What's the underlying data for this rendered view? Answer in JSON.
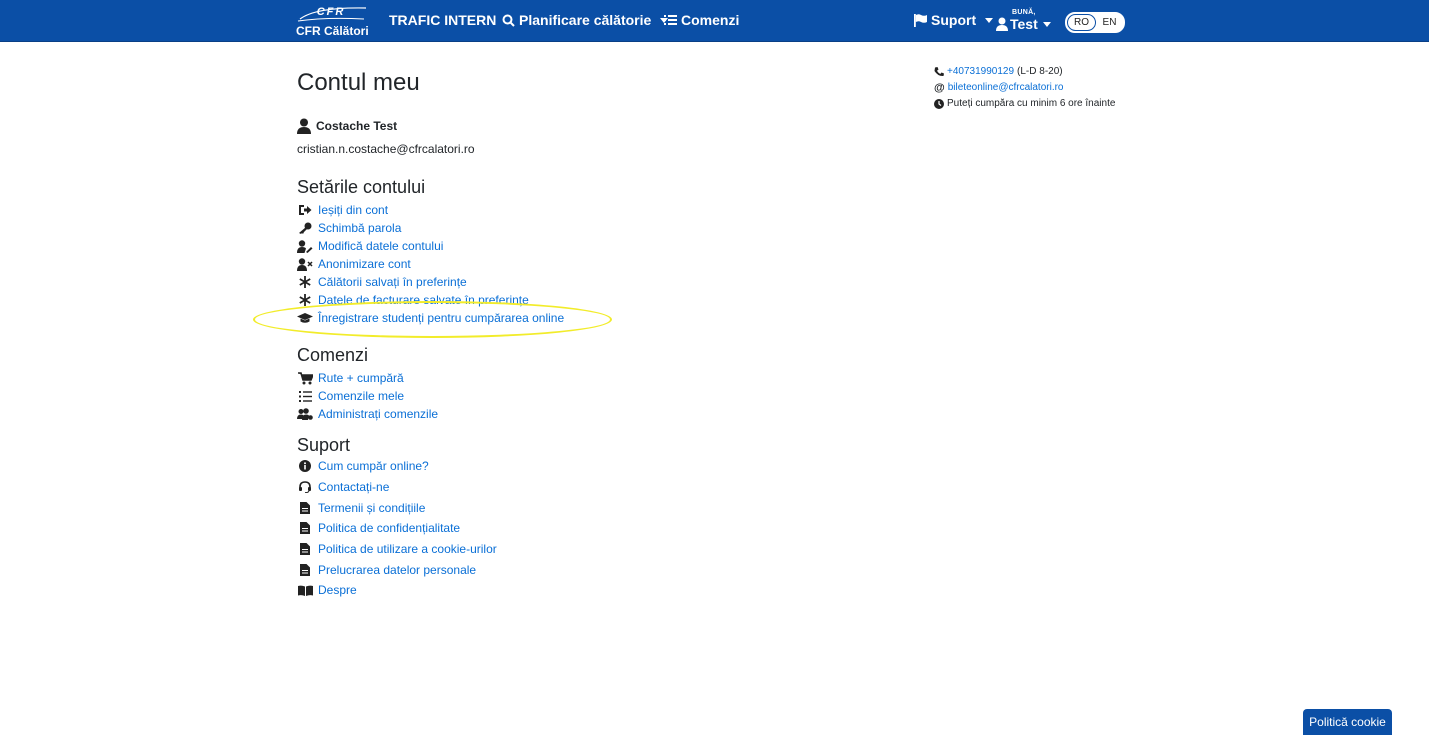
{
  "header": {
    "brand": {
      "mark": "CFR",
      "name": "CFR Călători"
    },
    "nav": {
      "trafic": "TRAFIC INTERN",
      "planificare": "Planificare călătorie",
      "comenzi": "Comenzi",
      "suport": "Suport"
    },
    "user": {
      "greeting": "BUNĂ,",
      "name": "Test"
    },
    "languages": [
      "RO",
      "EN"
    ],
    "active_language": "RO"
  },
  "page": {
    "title": "Contul meu",
    "user_name": "Costache Test",
    "user_email": "cristian.n.costache@cfrcalatori.ro"
  },
  "contact": {
    "phone": "+40731990129",
    "hours": "(L-D 8-20)",
    "email": "bileteonline@cfrcalatori.ro",
    "notice": "Puteți cumpăra cu minim 6 ore înainte"
  },
  "settings": {
    "title": "Setările contului",
    "items": [
      {
        "label": "Ieșiți din cont",
        "icon": "sign-out-icon"
      },
      {
        "label": "Schimbă parola",
        "icon": "key-icon"
      },
      {
        "label": "Modifică datele contului",
        "icon": "user-edit-icon"
      },
      {
        "label": "Anonimizare cont",
        "icon": "user-remove-icon"
      },
      {
        "label": "Călătorii salvați în preferințe",
        "icon": "asterisk-icon"
      },
      {
        "label": "Datele de facturare salvate în preferințe",
        "icon": "asterisk-icon"
      },
      {
        "label": "Înregistrare studenți pentru cumpărarea online",
        "icon": "graduation-cap-icon"
      }
    ]
  },
  "orders": {
    "title": "Comenzi",
    "items": [
      {
        "label": "Rute + cumpără",
        "icon": "cart-icon"
      },
      {
        "label": "Comenzile mele",
        "icon": "list-icon"
      },
      {
        "label": "Administrați comenzile",
        "icon": "users-cog-icon"
      }
    ]
  },
  "support": {
    "title": "Suport",
    "items": [
      {
        "label": "Cum cumpăr online?",
        "icon": "info-circle-icon"
      },
      {
        "label": "Contactați-ne",
        "icon": "headset-icon"
      },
      {
        "label": "Termenii și condițiile",
        "icon": "document-icon"
      },
      {
        "label": "Politica de confidențialitate",
        "icon": "document-icon"
      },
      {
        "label": "Politica de utilizare a cookie-urilor",
        "icon": "document-icon"
      },
      {
        "label": "Prelucrarea datelor personale",
        "icon": "document-icon"
      },
      {
        "label": "Despre",
        "icon": "book-icon"
      }
    ]
  },
  "cookie_button": "Politică cookie",
  "colors": {
    "navbar": "#0b4fa6",
    "link": "#0a6fd6",
    "highlight": "#f2ec2a"
  }
}
